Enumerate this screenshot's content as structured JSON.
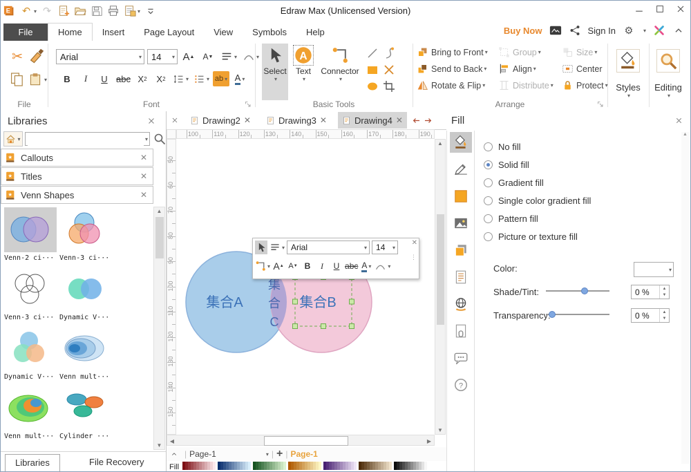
{
  "window": {
    "title": "Edraw Max (Unlicensed Version)"
  },
  "quick_access": {
    "icons": [
      {
        "name": "edraw-logo"
      },
      {
        "name": "undo-icon",
        "dropdown": true
      },
      {
        "name": "redo-icon",
        "disabled": true
      },
      {
        "name": "new-document-icon"
      },
      {
        "name": "open-file-icon"
      },
      {
        "name": "save-icon"
      },
      {
        "name": "print-icon"
      },
      {
        "name": "document-options-icon",
        "dropdown": true
      },
      {
        "name": "customize-quick-access-icon"
      }
    ]
  },
  "menu": {
    "tabs": [
      "File",
      "Home",
      "Insert",
      "Page Layout",
      "View",
      "Symbols",
      "Help"
    ],
    "active_tab": "Home",
    "buy_now_label": "Buy Now",
    "sign_in_label": "Sign In"
  },
  "ribbon": {
    "file_group": {
      "label": "File",
      "icons": [
        "cut-icon",
        "format-painter-icon",
        "copy-icon",
        "paste-icon"
      ]
    },
    "font_group": {
      "label": "Font",
      "font_name": "Arial",
      "font_size": "14",
      "row2_buttons": [
        {
          "glyph": "B",
          "style": "bold"
        },
        {
          "glyph": "I",
          "style": "italic"
        },
        {
          "glyph": "U",
          "style": "underline"
        },
        {
          "glyph": "abc",
          "style": "strike"
        },
        {
          "glyph": "X",
          "sub": "2",
          "style": "subscript"
        },
        {
          "glyph": "X",
          "sup": "2",
          "style": "superscript"
        },
        {
          "icon": "line-spacing-icon",
          "dropdown": true
        },
        {
          "icon": "bullets-icon",
          "dropdown": true
        },
        {
          "glyph": "ab",
          "style": "highlight",
          "dropdown": true
        },
        {
          "glyph": "A",
          "style": "font-color",
          "dropdown": true
        }
      ]
    },
    "basic_tools_group": {
      "label": "Basic Tools",
      "tools": [
        {
          "label": "Select",
          "icon": "select-cursor-icon",
          "pressed": true
        },
        {
          "label": "Text",
          "icon": "text-tool-icon",
          "pressed": false
        },
        {
          "label": "Connector",
          "icon": "connector-tool-icon",
          "pressed": false
        }
      ],
      "shape_tools": [
        "line-tool-icon",
        "curve-tool-icon",
        "rectangle-tool-icon",
        "cross-tool-icon",
        "ellipse-tool-icon",
        "crop-tool-icon"
      ]
    },
    "arrange_group": {
      "label": "Arrange",
      "columns": [
        [
          {
            "label": "Bring to Front",
            "icon": "bring-to-front-icon",
            "dropdown": true,
            "disabled": false
          },
          {
            "label": "Send to Back",
            "icon": "send-to-back-icon",
            "dropdown": true,
            "disabled": false
          },
          {
            "label": "Rotate & Flip",
            "icon": "rotate-flip-icon",
            "dropdown": true,
            "disabled": false
          }
        ],
        [
          {
            "label": "Group",
            "icon": "group-icon",
            "dropdown": true,
            "disabled": true
          },
          {
            "label": "Align",
            "icon": "align-icon",
            "dropdown": true,
            "disabled": false
          },
          {
            "label": "Distribute",
            "icon": "distribute-icon",
            "dropdown": true,
            "disabled": true
          }
        ],
        [
          {
            "label": "Size",
            "icon": "size-icon",
            "dropdown": true,
            "disabled": true
          },
          {
            "label": "Center",
            "icon": "center-icon",
            "dropdown": false,
            "disabled": false
          },
          {
            "label": "Protect",
            "icon": "protect-icon",
            "dropdown": true,
            "disabled": false
          }
        ]
      ]
    },
    "styles_group": {
      "label": "Styles",
      "icon": "styles-icon"
    },
    "editing_group": {
      "label": "Editing",
      "icon": "editing-icon"
    }
  },
  "libraries_panel": {
    "title": "Libraries",
    "search_value": "",
    "sections": [
      {
        "label": "Callouts"
      },
      {
        "label": "Titles"
      },
      {
        "label": "Venn Shapes"
      }
    ],
    "shapes": [
      {
        "label": "Venn-2 ci···",
        "icon": "venn-2-circles-shape",
        "selected": true
      },
      {
        "label": "Venn-3 ci···",
        "icon": "venn-3-circles-shape",
        "selected": false
      },
      {
        "label": "Venn-3 ci···",
        "icon": "venn-3-outline-shape",
        "selected": false
      },
      {
        "label": "Dynamic V···",
        "icon": "dynamic-venn-2-shape",
        "selected": false
      },
      {
        "label": "Dynamic V···",
        "icon": "dynamic-venn-3-shape",
        "selected": false
      },
      {
        "label": "Venn mult···",
        "icon": "venn-multi-blue-shape",
        "selected": false
      },
      {
        "label": "Venn mult···",
        "icon": "venn-multi-green-shape",
        "selected": false
      },
      {
        "label": "Cylinder ···",
        "icon": "cylinder-venn-shape",
        "selected": false
      }
    ],
    "bottom_tabs": [
      "Libraries",
      "File Recovery"
    ],
    "active_bottom_tab": "Libraries"
  },
  "document_area": {
    "tabs": [
      {
        "label": "Drawing2"
      },
      {
        "label": "Drawing3"
      },
      {
        "label": "Drawing4"
      }
    ],
    "active_tab": "Drawing4",
    "ruler_h": [
      100,
      110,
      120,
      130,
      140,
      150,
      160,
      170,
      180,
      190
    ],
    "ruler_v": [
      50,
      60,
      70,
      80,
      90,
      100,
      110,
      120,
      130,
      140,
      150
    ],
    "mini_toolbar": {
      "font_name": "Arial",
      "font_size": "14",
      "row2_buttons": [
        {
          "glyph": "A",
          "style": "grow"
        },
        {
          "glyph": "A",
          "style": "shrink"
        },
        {
          "glyph": "B",
          "style": "bold"
        },
        {
          "glyph": "I",
          "style": "italic"
        },
        {
          "glyph": "U",
          "style": "underline"
        },
        {
          "glyph": "abc",
          "style": "strike"
        },
        {
          "glyph": "A",
          "style": "font-color",
          "dropdown": true
        },
        {
          "icon": "arc-icon",
          "dropdown": true
        }
      ]
    },
    "venn": {
      "set_a_label": "集合A",
      "set_b_label": "集合B",
      "set_c_lines": [
        "集",
        "合",
        "C"
      ]
    },
    "page_bar": {
      "page_tab": "Page-1",
      "add_page": "+",
      "current_page": "Page-1"
    },
    "palette_label": "Fill"
  },
  "fill_panel": {
    "title": "Fill",
    "options": [
      "No fill",
      "Solid fill",
      "Gradient fill",
      "Single color gradient fill",
      "Pattern fill",
      "Picture or texture fill"
    ],
    "selected_option": "Solid fill",
    "color_label": "Color:",
    "shade_tint_label": "Shade/Tint:",
    "shade_tint_value": "0 %",
    "shade_slider_pos": 0.62,
    "transparency_label": "Transparency:",
    "transparency_value": "0 %",
    "transparency_slider_pos": 0.05,
    "side_icons": [
      "fill-bucket-icon",
      "line-style-icon",
      "quick-color-icon",
      "picture-icon",
      "shadow-icon",
      "note-icon",
      "hyperlink-icon",
      "attachment-icon",
      "comment-icon",
      "help-icon"
    ]
  },
  "palette_groups": [
    [
      "#7d0f14",
      "#fce8ec"
    ],
    [
      "#0b2f6e",
      "#d9eefb"
    ],
    [
      "#155421",
      "#dbf2d0"
    ],
    [
      "#b05a00",
      "#fdf7c5"
    ],
    [
      "#482071",
      "#eee4f6"
    ],
    [
      "#4d2c0a",
      "#f0e2ca"
    ],
    [
      "#0d0d0d",
      "#f7f7f7"
    ]
  ],
  "colors": {
    "accent": "#e8882d",
    "venn_blue_fill": "#a9cdea",
    "venn_blue_stroke": "#8cb2dc",
    "venn_pink_fill": "#f3c9da",
    "venn_pink_stroke": "#dfa5c1",
    "venn_overlap_fill": "#b1a5d4",
    "venn_label": "#3c72b8",
    "venn_overlap_label": "#4968ae",
    "selection_green": "#6fae4e"
  }
}
